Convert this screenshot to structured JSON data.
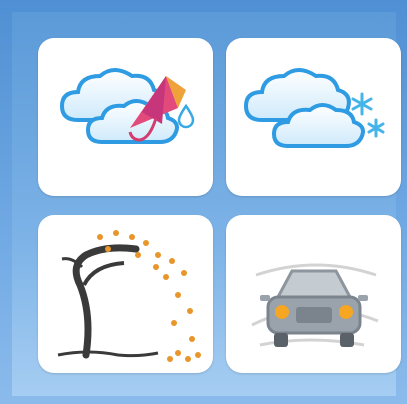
{
  "options": [
    {
      "id": "rain",
      "icon": "rain-umbrella-icon"
    },
    {
      "id": "snow",
      "icon": "snow-cloud-icon"
    },
    {
      "id": "wind",
      "icon": "windy-tree-icon"
    },
    {
      "id": "fog",
      "icon": "foggy-car-icon"
    }
  ],
  "colors": {
    "background": "#5b9ad8",
    "tile": "#ffffff",
    "cloud": "#3aa0e6",
    "snowflake": "#45b4e8",
    "leaf": "#e8952a",
    "car": "#9aa3ab",
    "headlight": "#f5a623"
  }
}
